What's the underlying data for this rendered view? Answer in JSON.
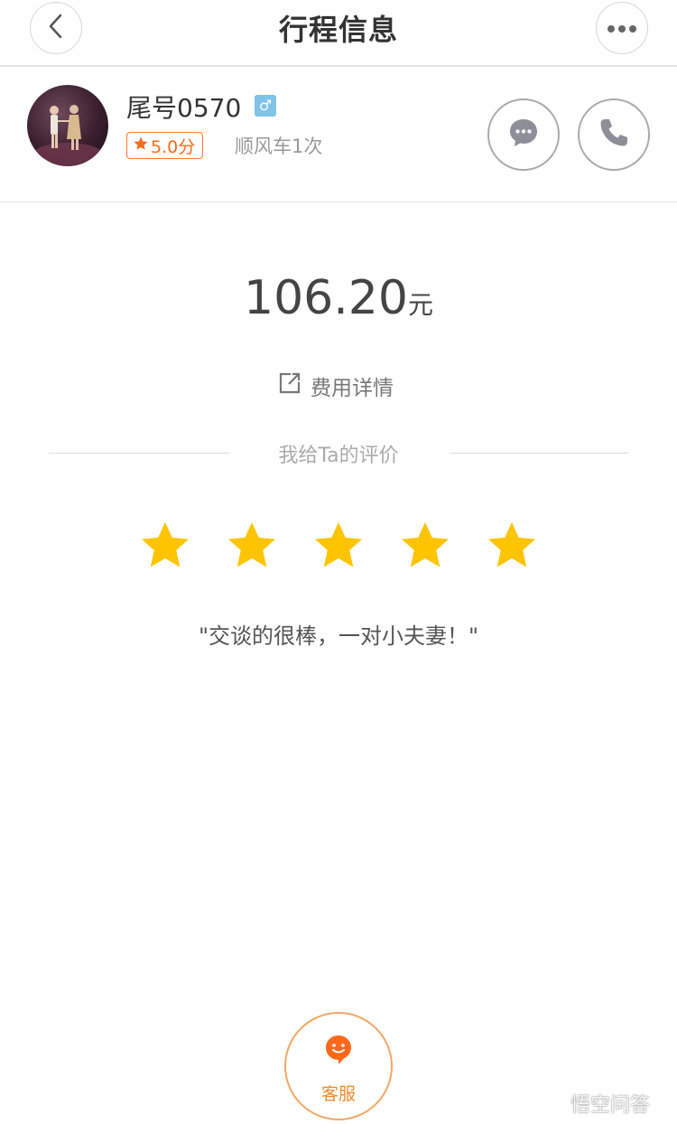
{
  "header": {
    "title": "行程信息"
  },
  "driver": {
    "name": "尾号0570",
    "gender_symbol": "♂",
    "rating": "5.0分",
    "rides": "顺风车1次"
  },
  "trip": {
    "amount": "106.20",
    "unit": "元",
    "fee_detail_label": "费用详情"
  },
  "review": {
    "caption": "我给Ta的评价",
    "stars": 5,
    "max_stars": 5,
    "comment": "\"交谈的很棒，一对小夫妻！\""
  },
  "service": {
    "label": "客服"
  },
  "watermark": {
    "text": "悟空问答"
  },
  "colors": {
    "accent_orange": "#ff6a1a",
    "star_yellow": "#ffc400",
    "gender_blue": "#7fc3e8"
  }
}
